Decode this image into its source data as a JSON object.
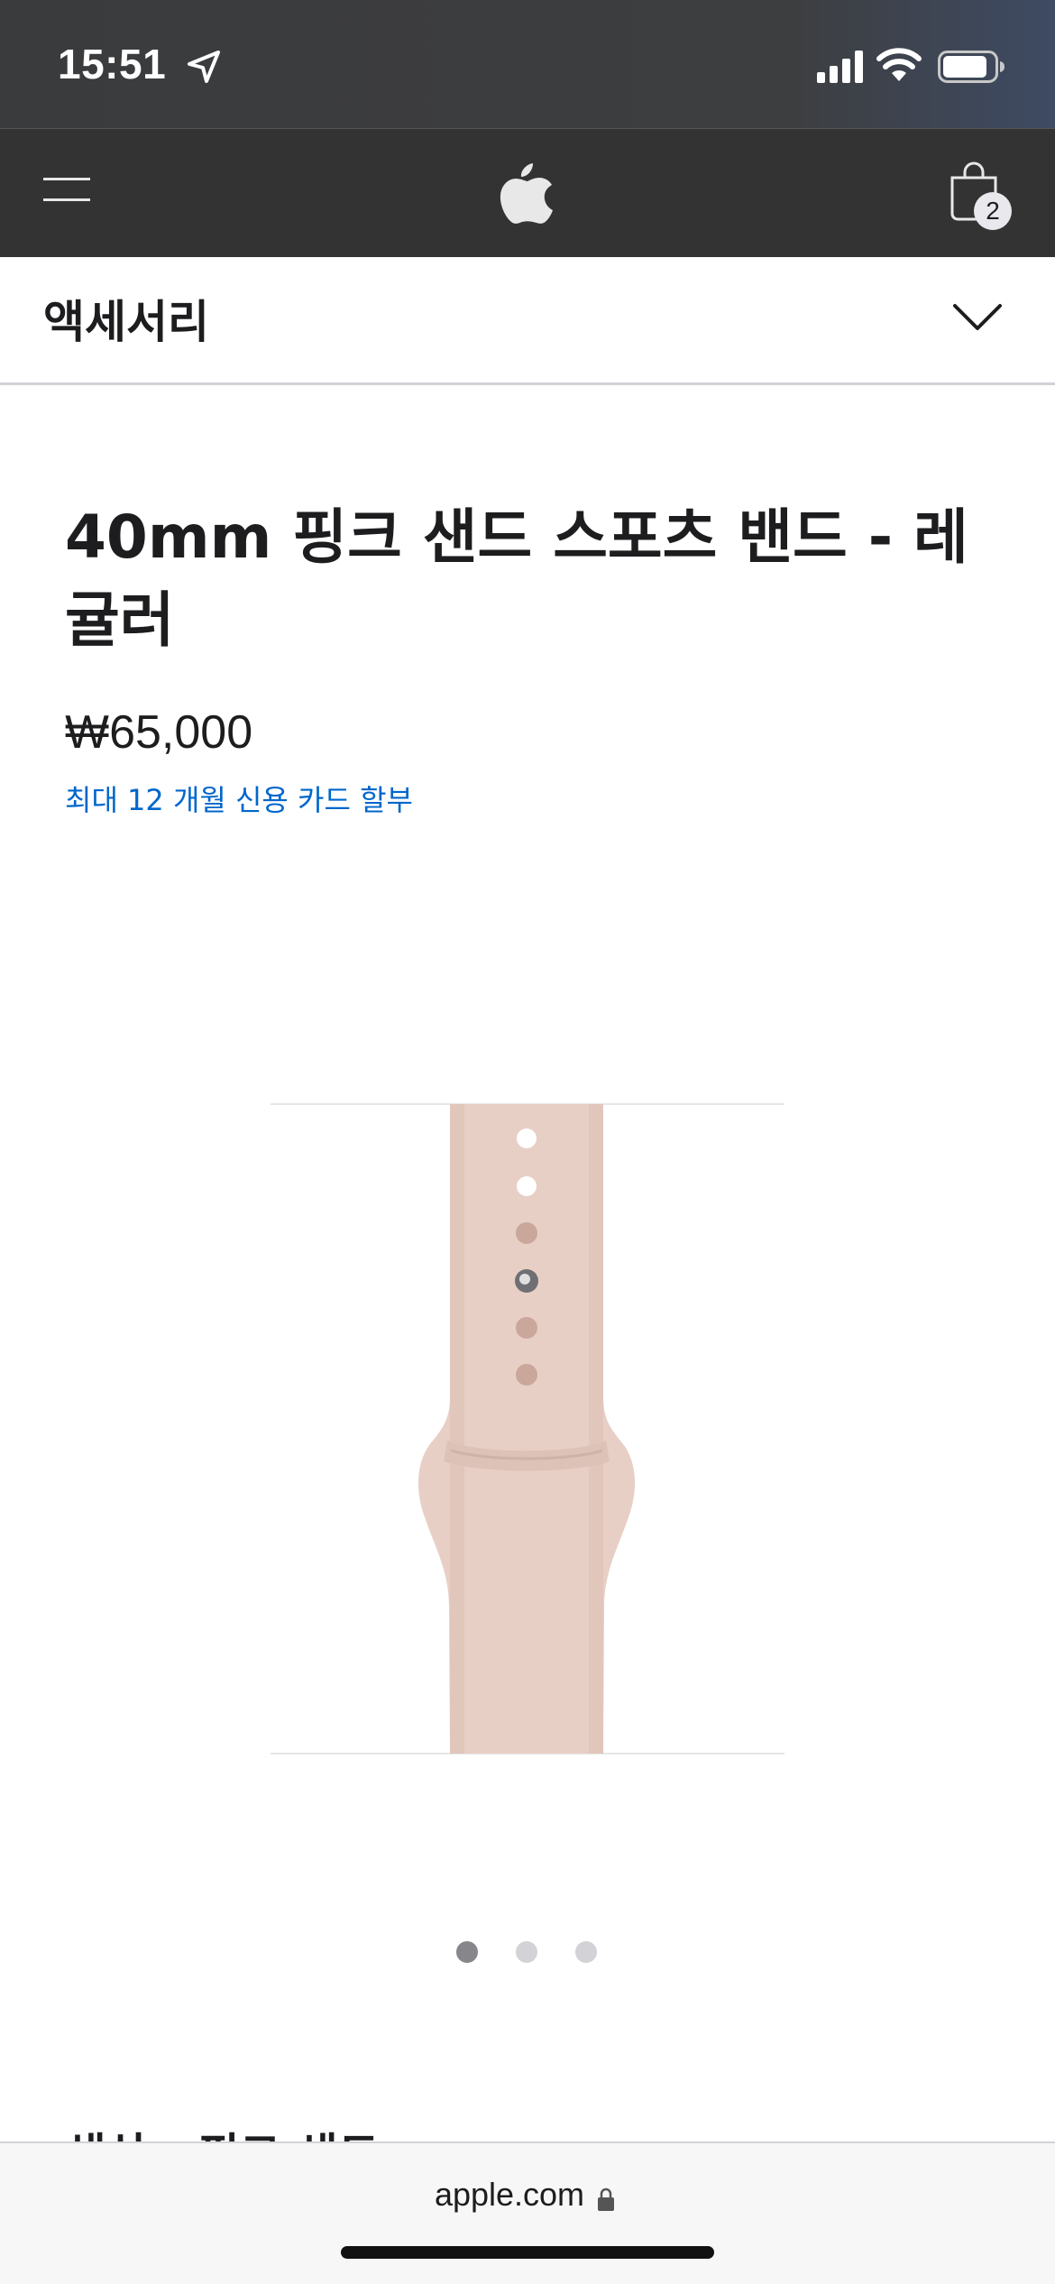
{
  "status_bar": {
    "time": "15:51",
    "icons": [
      "location-arrow-icon",
      "cellular-signal-icon",
      "wifi-icon",
      "battery-icon"
    ]
  },
  "nav": {
    "menu_icon": "menu-icon",
    "logo_icon": "apple-logo-icon",
    "bag_icon": "shopping-bag-icon",
    "bag_count": "2"
  },
  "sub_nav": {
    "title": "액세서리",
    "toggle_icon": "chevron-down-icon"
  },
  "product": {
    "title": "40mm 핑크 샌드 스포츠 밴드 - 레귤러",
    "price": "₩65,000",
    "installment_link": "최대 12 개월 신용 카드 할부",
    "image_icon": "watch-band-image",
    "band_color": "#e8cfc5"
  },
  "carousel": {
    "dots": 3,
    "active_index": 0
  },
  "next_section": {
    "heading": "색상 - 핑크 샌드"
  },
  "browser": {
    "url": "apple.com",
    "lock_icon": "lock-icon"
  },
  "colors": {
    "status_bg": "#3d3e40",
    "nav_bg": "#333333",
    "link": "#0066cc",
    "text": "#1d1d1f"
  }
}
